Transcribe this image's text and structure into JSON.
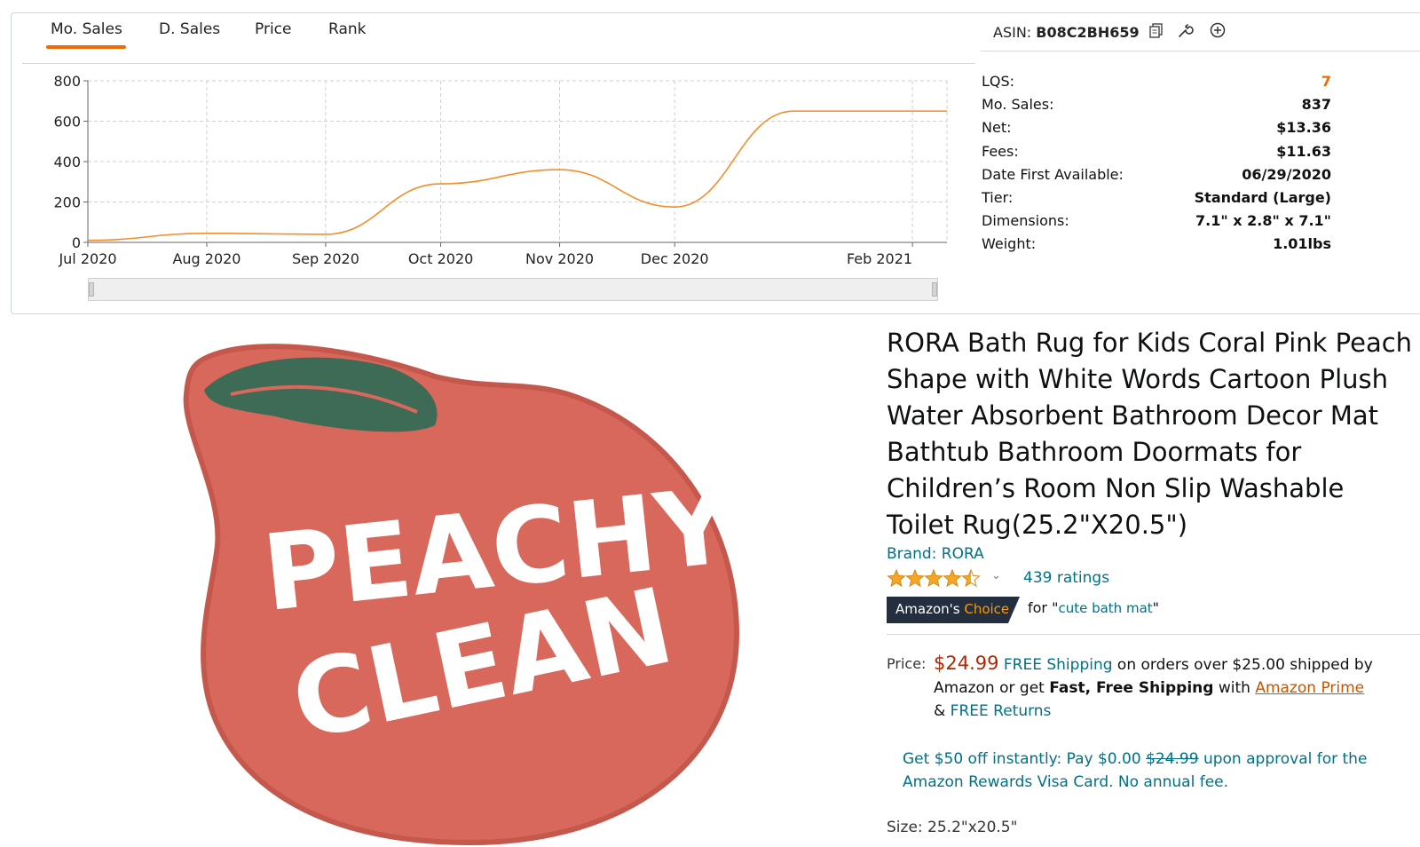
{
  "tabs": [
    "Mo. Sales",
    "D. Sales",
    "Price",
    "Rank"
  ],
  "active_tab": "Mo. Sales",
  "asin": {
    "label": "ASIN:",
    "value": "B08C2BH659",
    "icons": [
      "copy-icon",
      "wrench-icon",
      "add-circle-icon"
    ]
  },
  "stats": [
    {
      "label": "LQS:",
      "value": "7"
    },
    {
      "label": "Mo. Sales:",
      "value": "837"
    },
    {
      "label": "Net:",
      "value": "$13.36"
    },
    {
      "label": "Fees:",
      "value": "$11.63"
    },
    {
      "label": "Date First Available:",
      "value": "06/29/2020"
    },
    {
      "label": "Tier:",
      "value": "Standard (Large)"
    },
    {
      "label": "Dimensions:",
      "value": "7.1\" x 2.8\" x 7.1\""
    },
    {
      "label": "Weight:",
      "value": "1.01lbs"
    }
  ],
  "chart_data": {
    "type": "line",
    "title": "",
    "xlabel": "",
    "ylabel": "",
    "ylim": [
      0,
      800
    ],
    "yticks": [
      0,
      200,
      400,
      600,
      800
    ],
    "xticks": [
      "Jul 2020",
      "Aug 2020",
      "Sep 2020",
      "Oct 2020",
      "Nov 2020",
      "Dec 2020",
      "Feb 2021"
    ],
    "grid": true,
    "x": [
      "2020-07-01",
      "2020-08-01",
      "2020-09-01",
      "2020-10-01",
      "2020-11-01",
      "2020-12-01",
      "2021-01-01",
      "2021-02-01",
      "2021-02-10"
    ],
    "series": [
      {
        "name": "",
        "values": [
          10,
          45,
          40,
          290,
          360,
          175,
          650,
          650,
          650
        ],
        "color": "#f28e2b"
      }
    ]
  },
  "product": {
    "image_text": [
      "PEACHY",
      "CLEAN"
    ],
    "title": "RORA Bath Rug for Kids Coral Pink Peach Shape with White Words Cartoon Plush Water Absorbent Bathroom Decor Mat Bathtub Bathroom Doormats for Children’s Room Non Slip Washable Toilet Rug(25.2\"X20.5\")",
    "brand": "Brand: RORA",
    "rating": 4.5,
    "ratings_count": "439 ratings",
    "choice_badge_pre": "Amazon's",
    "choice_badge_post": "Choice",
    "choice_for_pre": "for \"",
    "choice_for_link": "cute bath mat",
    "choice_for_post": "\"",
    "price_label": "Price:",
    "price": "$24.99",
    "free_shipping": "FREE Shipping",
    "shipping_text1": " on orders over $25.00 shipped by Amazon or get ",
    "fast_free": "Fast, Free Shipping",
    "shipping_with": " with ",
    "prime_link": "Amazon Prime",
    "returns_amp": "& ",
    "returns_link": "FREE Returns",
    "offer_pre": "Get $50 off instantly: Pay $0.00 ",
    "offer_strike": "$24.99",
    "offer_post": " upon approval for the Amazon Rewards Visa Card. No annual fee.",
    "size_line": "Size: 25.2\"x20.5\""
  },
  "colors": {
    "accent": "#ef6a00",
    "link": "#007185",
    "price": "#b12704",
    "rug": "#d9685c",
    "leaf": "#3d6b55"
  }
}
